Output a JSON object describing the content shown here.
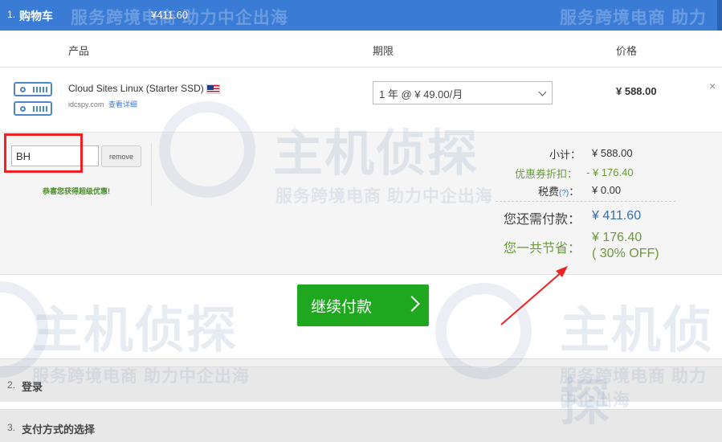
{
  "step1": {
    "number": "1.",
    "title": "购物车",
    "amount": "¥411.60"
  },
  "columns": {
    "product": "产品",
    "period": "期限",
    "price": "价格"
  },
  "product": {
    "name": "Cloud Sites Linux (Starter SSD)",
    "domain": "idcspy.com",
    "details_link": "查看详细",
    "period_value": "1 年 @ ¥ 49.00/月",
    "price": "¥ 588.00",
    "remove_symbol": "×",
    "icon": "server-icon",
    "flag": "us-flag-icon"
  },
  "promo": {
    "code_value": "BH",
    "remove_label": "remove",
    "message": "恭喜您获得超级优惠!"
  },
  "summary": {
    "subtotal_label": "小计：",
    "subtotal_value": "¥ 588.00",
    "discount_label": "优惠券折扣：",
    "discount_value": "- ¥ 176.40",
    "tax_label": "税费",
    "tax_help": "(?)",
    "tax_colon": "：",
    "tax_value": "¥ 0.00",
    "due_label": "您还需付款：",
    "due_value": "¥ 411.60",
    "saved_label": "您一共节省：",
    "saved_value": "¥ 176.40",
    "saved_percent": "( 30% OFF)"
  },
  "checkout": {
    "label": "继续付款"
  },
  "step2": {
    "number": "2.",
    "title": "登录"
  },
  "step3": {
    "number": "3.",
    "title": "支付方式的选择"
  },
  "watermark": {
    "brand": "主机侦探",
    "slogan": "服务跨境电商 助力中企出海"
  },
  "colors": {
    "accent": "#3a7bd5",
    "button": "#1fa81f",
    "discount": "#6a9a3a",
    "highlight": "#e22222"
  }
}
